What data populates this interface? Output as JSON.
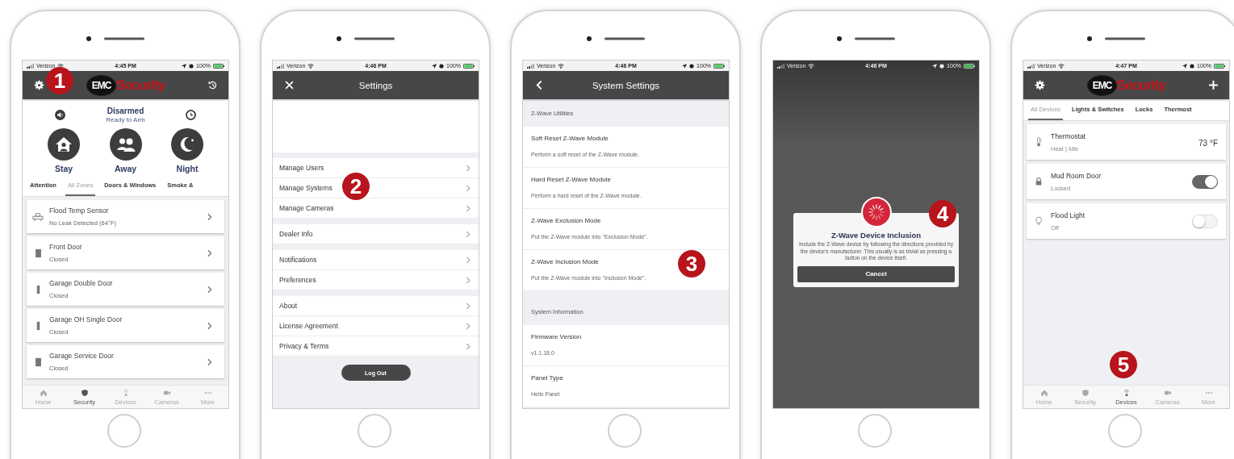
{
  "phones": [
    {
      "kind": "security",
      "step_badge": "1",
      "status_bar": {
        "carrier": "Verizon",
        "time": "4:45 PM",
        "battery": "100%"
      },
      "header": {
        "left_button": {
          "kind": "gear"
        },
        "logo": {
          "badge": "EMC",
          "wordmark": "Security"
        },
        "right_button": {
          "kind": "history"
        }
      },
      "arm_status": {
        "title": "Disarmed",
        "subtitle": "Ready to Arm"
      },
      "arm_modes": [
        {
          "kind": "stay",
          "label": "Stay"
        },
        {
          "kind": "away",
          "label": "Away"
        },
        {
          "kind": "night",
          "label": "Night"
        }
      ],
      "tabs": [
        {
          "label": "Attention",
          "selected": false
        },
        {
          "label": "All Zones",
          "selected": true
        },
        {
          "label": "Doors & Windows",
          "selected": false
        },
        {
          "label": "Smoke &",
          "selected": false
        }
      ],
      "zones": [
        {
          "kind": "sensor",
          "name": "Flood Temp Sensor",
          "status": "No Leak Detected (64°F)"
        },
        {
          "kind": "door",
          "name": "Front Door",
          "status": "Closed"
        },
        {
          "kind": "garage",
          "name": "Garage Double Door",
          "status": "Closed"
        },
        {
          "kind": "garage",
          "name": "Garage OH Single Door",
          "status": "Closed"
        },
        {
          "kind": "door",
          "name": "Garage Service Door",
          "status": "Closed"
        }
      ],
      "bottom_nav": [
        {
          "kind": "home",
          "label": "Home",
          "selected": false
        },
        {
          "kind": "security",
          "label": "Security",
          "selected": true
        },
        {
          "kind": "devices",
          "label": "Devices",
          "selected": false
        },
        {
          "kind": "cameras",
          "label": "Cameras",
          "selected": false
        },
        {
          "kind": "more",
          "label": "More",
          "selected": false
        }
      ]
    },
    {
      "kind": "settings",
      "step_badge": "2",
      "status_bar": {
        "carrier": "Verizon",
        "time": "4:46 PM",
        "battery": "100%"
      },
      "header": {
        "left_button": {
          "kind": "close"
        },
        "title": "Settings"
      },
      "menu_groups": [
        {
          "items": [
            "Manage Users",
            "Manage Systems",
            "Manage Cameras"
          ]
        },
        {
          "items": [
            "Dealer Info"
          ]
        },
        {
          "items": [
            "Notifications",
            "Preferences"
          ]
        },
        {
          "items": [
            "About",
            "License Agreement",
            "Privacy & Terms"
          ]
        }
      ],
      "logout_button": "Log Out"
    },
    {
      "kind": "system",
      "step_badge": "3",
      "status_bar": {
        "carrier": "Verizon",
        "time": "4:46 PM",
        "battery": "100%"
      },
      "header": {
        "left_button": {
          "kind": "back"
        },
        "title": "System Settings"
      },
      "sections": [
        {
          "title": "Z-Wave Utilities",
          "items": [
            {
              "title": "Soft Reset Z-Wave Module",
              "subtitle": "Perform a soft reset of the Z-Wave module."
            },
            {
              "title": "Hard Reset Z-Wave Module",
              "subtitle": "Perform a hard reset of the Z-Wave module."
            },
            {
              "title": "Z-Wave Exclusion Mode",
              "subtitle": "Put the Z-Wave module into \"Exclusion Mode\"."
            },
            {
              "title": "Z-Wave Inclusion Mode",
              "subtitle": "Put the Z-Wave module into \"Inclusion Mode\"."
            }
          ]
        },
        {
          "title": "System Information",
          "items": [
            {
              "title": "Firmware Version",
              "subtitle": "v1.1.18.0"
            },
            {
              "title": "Panel Type",
              "subtitle": "Helix Panel"
            }
          ]
        }
      ]
    },
    {
      "kind": "inclusion",
      "step_badge": "4",
      "status_bar": {
        "carrier": "Verizon",
        "time": "4:46 PM",
        "battery": "100%"
      },
      "dialog": {
        "title": "Z-Wave Device Inclusion",
        "message": "Include the Z-Wave device by following the directions provided by the device’s manufacturer. This usually is as trivial as pressing a button on the device itself.",
        "button": "Cancel"
      }
    },
    {
      "kind": "devices",
      "step_badge": "5",
      "status_bar": {
        "carrier": "Verizon",
        "time": "4:47 PM",
        "battery": "100%"
      },
      "header": {
        "left_button": {
          "kind": "gear"
        },
        "logo": {
          "badge": "EMC",
          "wordmark": "Security"
        },
        "right_button": {
          "kind": "plus"
        }
      },
      "tabs": [
        {
          "label": "All Devices",
          "selected": true
        },
        {
          "label": "Lights & Switches",
          "selected": false
        },
        {
          "label": "Locks",
          "selected": false
        },
        {
          "label": "Thermost",
          "selected": false
        }
      ],
      "devices": [
        {
          "kind": "thermostat",
          "name": "Thermostat",
          "status": "Heat | Idle",
          "reading": "73 °F"
        },
        {
          "kind": "lock",
          "name": "Mud Room Door",
          "status": "Locked",
          "on": true
        },
        {
          "kind": "light",
          "name": "Flood Light",
          "status": "Off",
          "on": false
        }
      ],
      "bottom_nav": [
        {
          "kind": "home",
          "label": "Home",
          "selected": false
        },
        {
          "kind": "security",
          "label": "Security",
          "selected": false
        },
        {
          "kind": "devices",
          "label": "Devices",
          "selected": true
        },
        {
          "kind": "cameras",
          "label": "Cameras",
          "selected": false
        },
        {
          "kind": "more",
          "label": "More",
          "selected": false
        }
      ]
    }
  ]
}
